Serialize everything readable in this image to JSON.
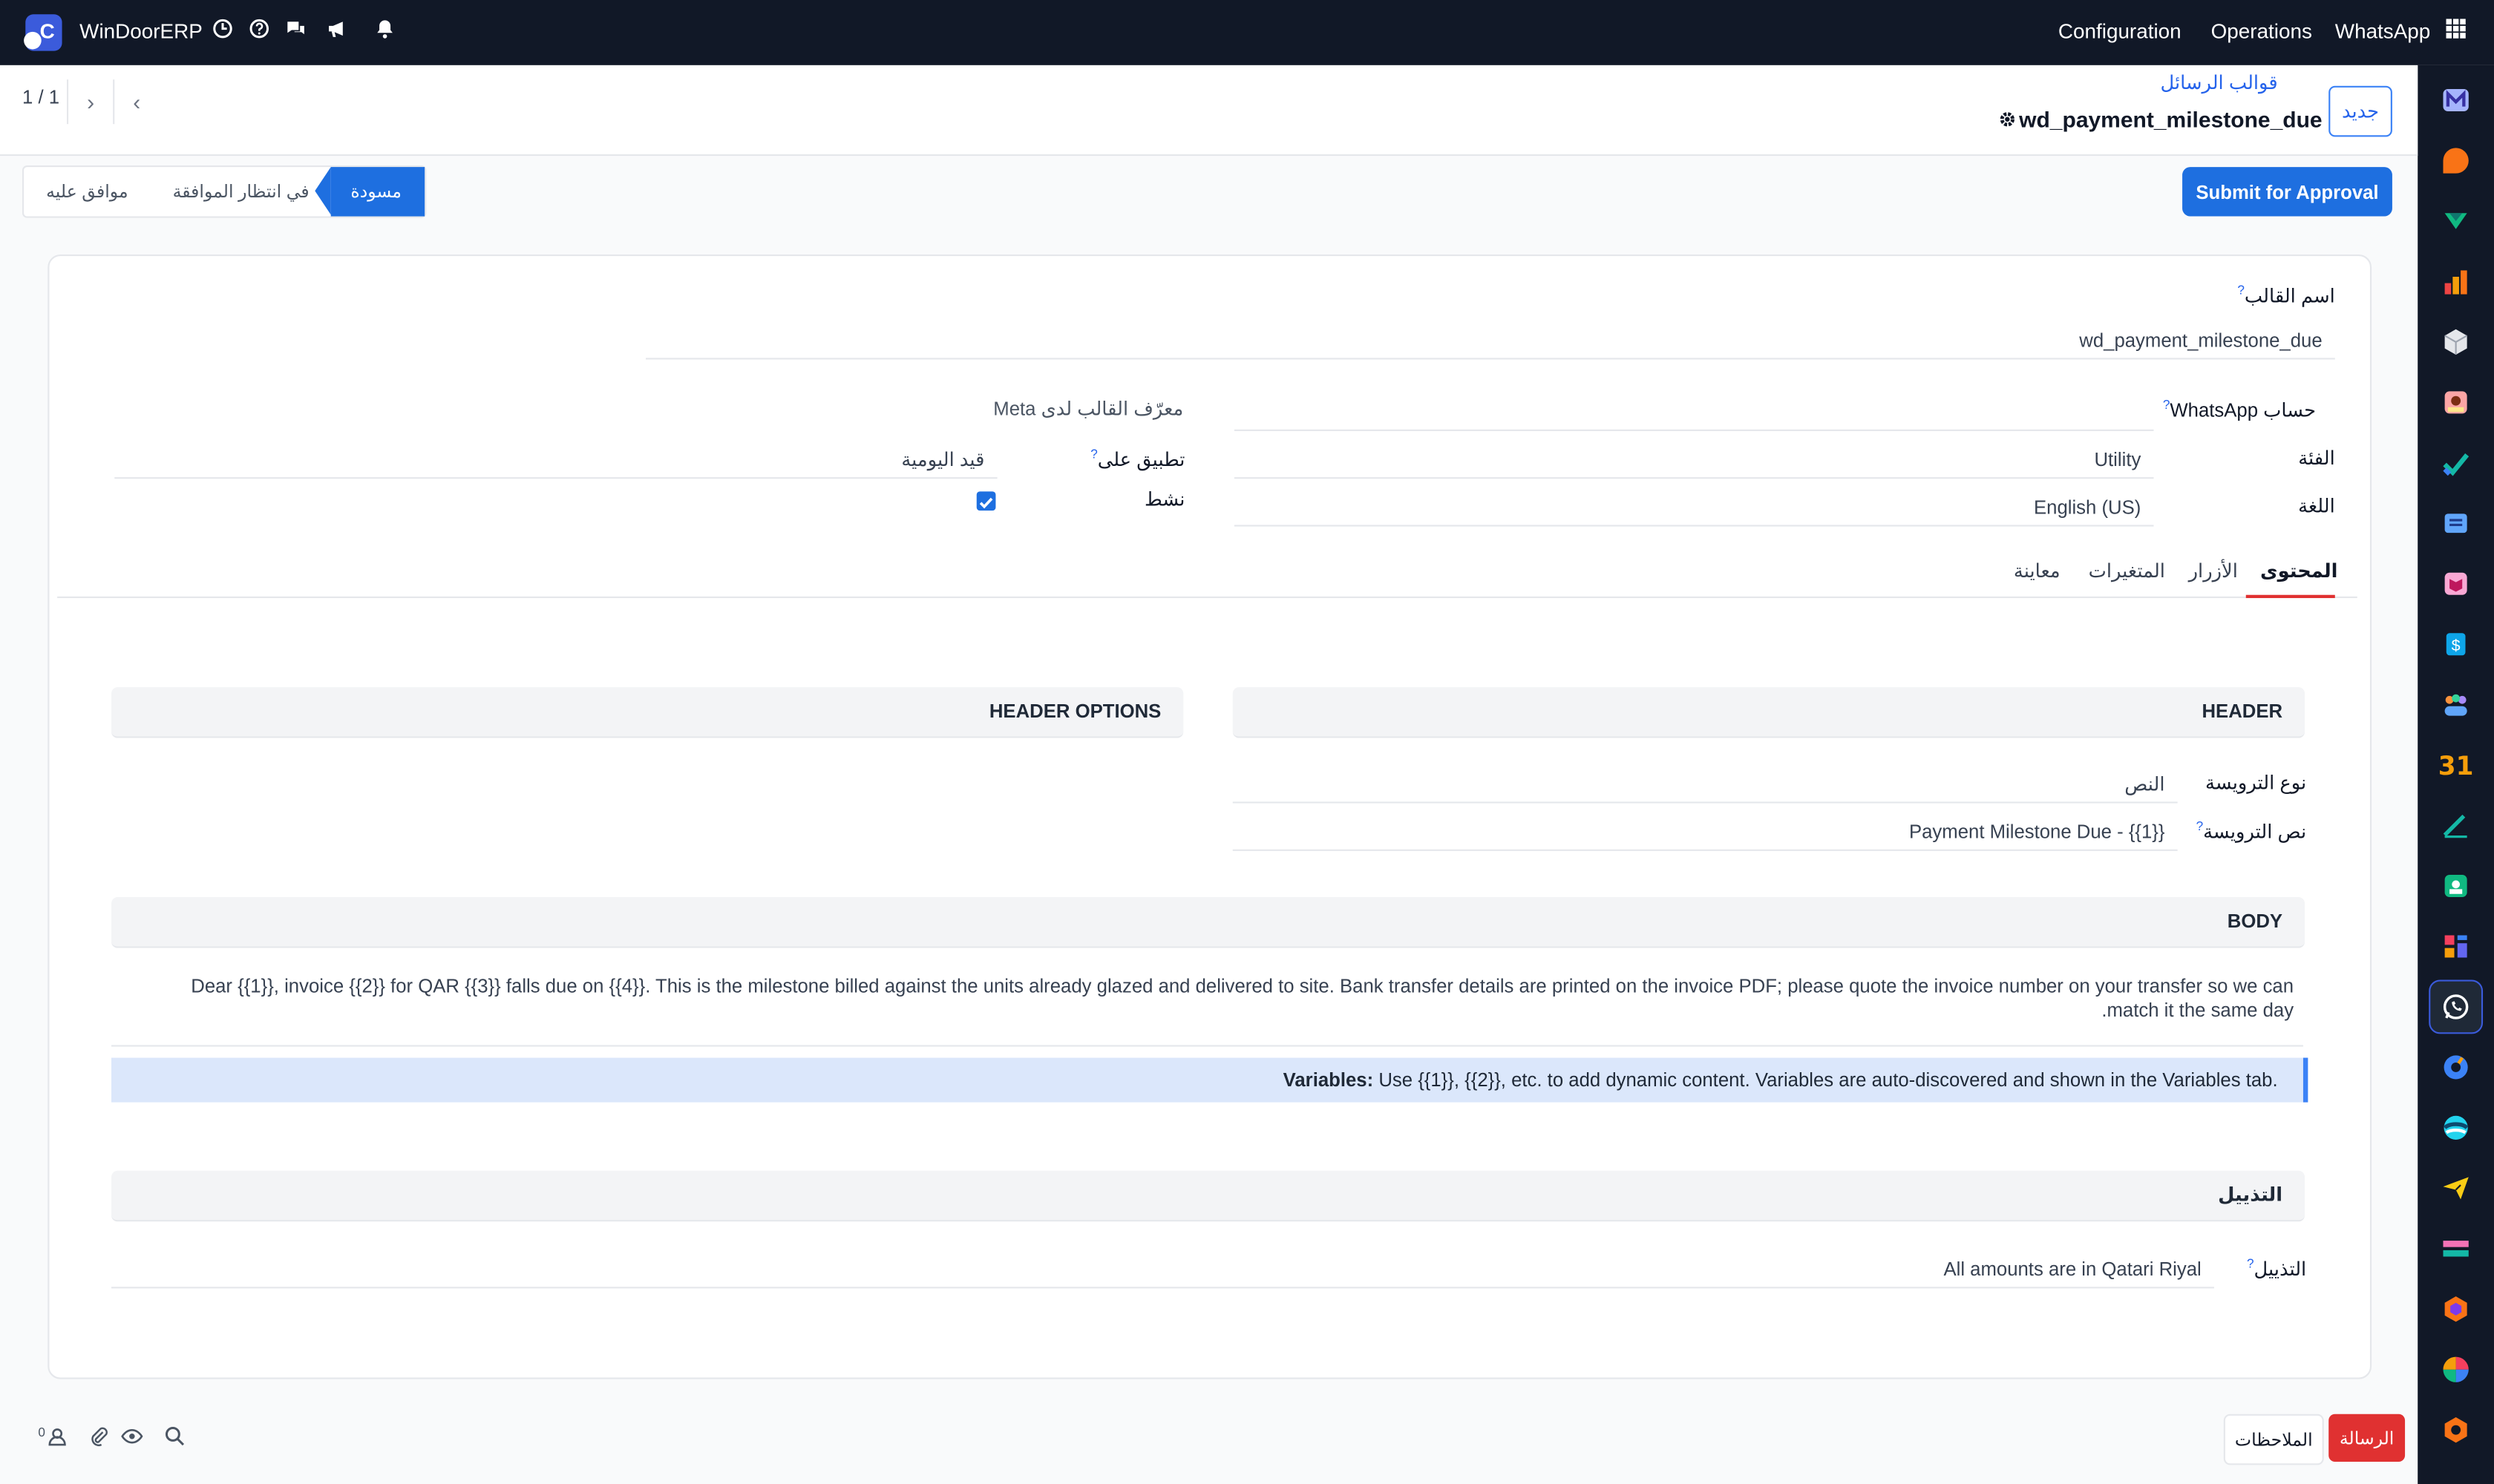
{
  "app": {
    "brand": "WinDoorERP",
    "logo_letter": "C"
  },
  "navbar": {
    "menus": [
      "Configuration",
      "Operations",
      "WhatsApp"
    ]
  },
  "control_panel": {
    "new_button": "جديد",
    "breadcrumb": "قوالب الرسائل",
    "record_title": "wd_payment_milestone_due",
    "pager": "1 / 1"
  },
  "statusbar": {
    "submit_label": "Submit for Approval",
    "stages": [
      "مسودة",
      "في انتظار الموافقة",
      "موافق عليه"
    ],
    "active_stage": "مسودة"
  },
  "form": {
    "template_name_label": "اسم القالب",
    "template_name_value": "wd_payment_milestone_due",
    "whatsapp_account_label": "حساب WhatsApp",
    "meta_id_label": "معرّف القالب لدى Meta",
    "category_label": "الفئة",
    "category_value": "Utility",
    "apply_on_label": "تطبيق على",
    "apply_on_value": "قيد اليومية",
    "language_label": "اللغة",
    "language_value": "English (US)",
    "active_label": "نشط",
    "active_checked": true
  },
  "tabs": [
    "المحتوى",
    "الأزرار",
    "المتغيرات",
    "معاينة"
  ],
  "active_tab": "المحتوى",
  "content": {
    "header_title": "HEADER",
    "header_options_title": "HEADER OPTIONS",
    "header_type_label": "نوع الترويسة",
    "header_type_value": "النص",
    "header_text_label": "نص الترويسة",
    "header_text_value": "Payment Milestone Due - {{1}}",
    "body_title": "BODY",
    "body_text": "Dear {{1}}, invoice {{2}} for QAR {{3}} falls due on {{4}}. This is the milestone billed against the units already glazed and delivered to site. Bank transfer details are printed on the invoice PDF; please quote the invoice number on your transfer so we can match it the same day.",
    "variables_bold": "Variables:",
    "variables_text": "Use {{1}}, {{2}}, etc. to add dynamic content. Variables are auto-discovered and shown in the Variables tab.",
    "footer_title": "التذييل",
    "footer_label": "التذييل",
    "footer_value": "All amounts are in Qatari Riyal"
  },
  "chatter": {
    "message_button": "الرسالة",
    "notes_button": "الملاحظات",
    "followers_count": "0"
  },
  "colors": {
    "navbar": "#111827",
    "primary": "#1e6fe0",
    "chatter_message": "#e03131"
  }
}
